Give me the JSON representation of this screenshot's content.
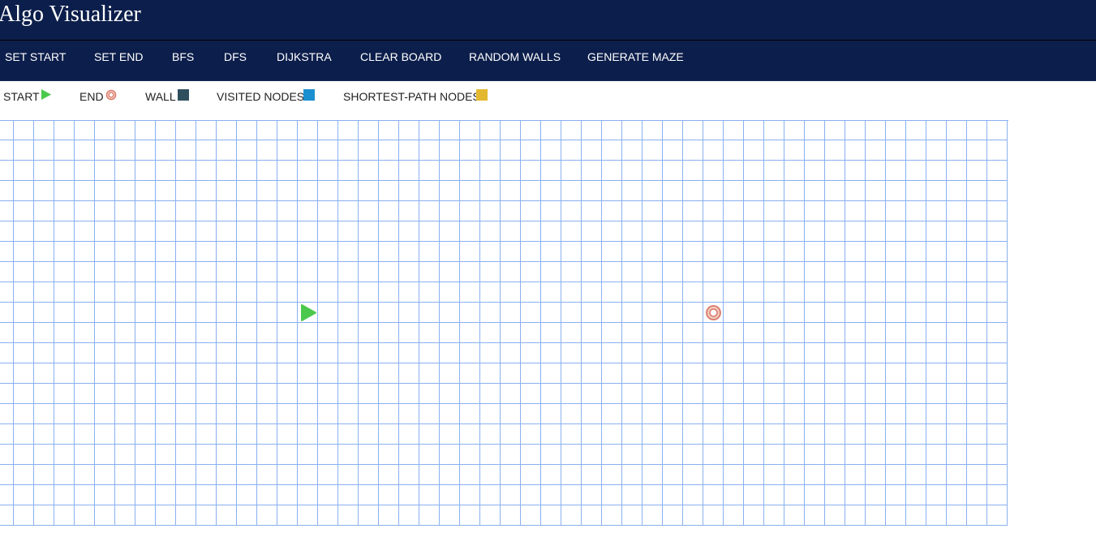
{
  "app": {
    "title": "Algo Visualizer"
  },
  "nav": {
    "items": [
      {
        "label": "SET START",
        "name": "set-start-button"
      },
      {
        "label": "SET END",
        "name": "set-end-button"
      },
      {
        "label": "BFS",
        "name": "bfs-button"
      },
      {
        "label": "DFS",
        "name": "dfs-button"
      },
      {
        "label": "DIJKSTRA",
        "name": "dijkstra-button"
      },
      {
        "label": "CLEAR BOARD",
        "name": "clear-board-button"
      },
      {
        "label": "RANDOM WALLS",
        "name": "random-walls-button"
      },
      {
        "label": "GENERATE MAZE",
        "name": "generate-maze-button"
      }
    ]
  },
  "legend": {
    "start": {
      "label": "START",
      "icon": "play-triangle-icon",
      "color": "#4cc94c"
    },
    "end": {
      "label": "END",
      "icon": "target-icon",
      "color": "#e07a6a"
    },
    "wall": {
      "label": "WALL",
      "color": "#2f4f5f"
    },
    "visited": {
      "label": "VISITED NODES",
      "color": "#1a8fd0"
    },
    "shortest": {
      "label": "SHORTEST-PATH NODES",
      "color": "#e3b82e"
    }
  },
  "grid": {
    "rows": 20,
    "cols": 50,
    "start": {
      "row": 9,
      "col": 15
    },
    "end": {
      "row": 9,
      "col": 35
    },
    "line_color": "#8ab0f0"
  }
}
